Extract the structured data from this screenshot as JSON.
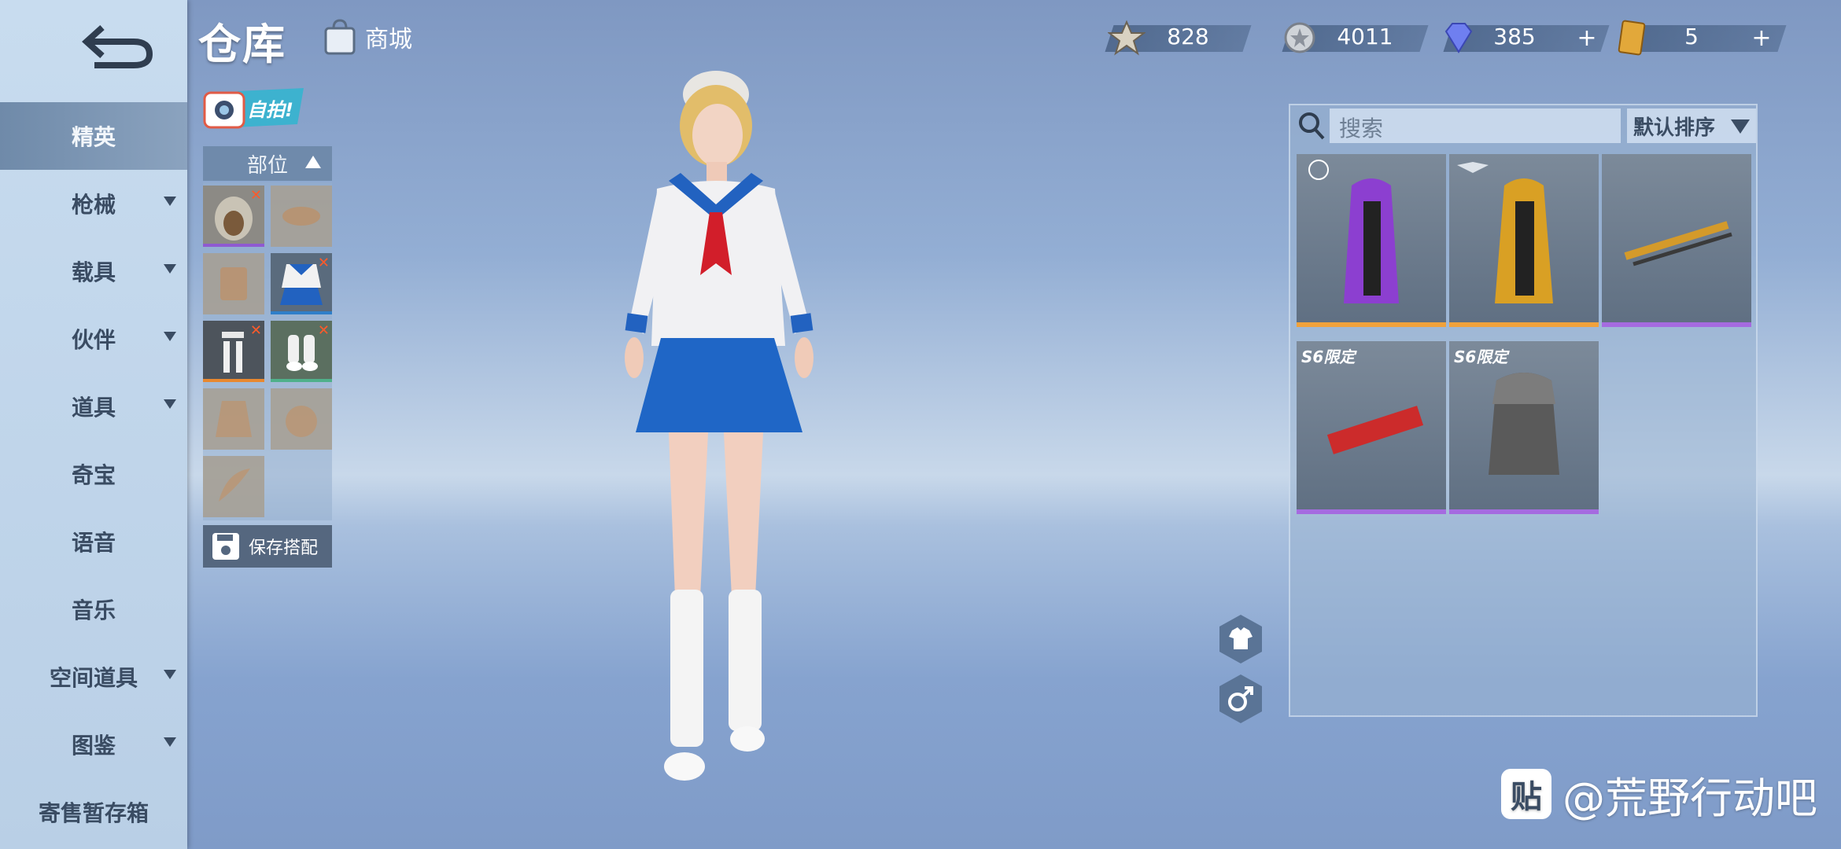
{
  "title": "仓库",
  "shop_label": "商城",
  "selfie_label": "自拍!",
  "sidebar": {
    "items": [
      {
        "label": "精英",
        "active": true,
        "dropdown": false
      },
      {
        "label": "枪械",
        "active": false,
        "dropdown": true
      },
      {
        "label": "载具",
        "active": false,
        "dropdown": true
      },
      {
        "label": "伙伴",
        "active": false,
        "dropdown": true
      },
      {
        "label": "道具",
        "active": false,
        "dropdown": true
      },
      {
        "label": "奇宝",
        "active": false,
        "dropdown": false
      },
      {
        "label": "语音",
        "active": false,
        "dropdown": false
      },
      {
        "label": "音乐",
        "active": false,
        "dropdown": false
      },
      {
        "label": "空间道具",
        "active": false,
        "dropdown": true
      },
      {
        "label": "图鉴",
        "active": false,
        "dropdown": true
      },
      {
        "label": "寄售暂存箱",
        "active": false,
        "dropdown": false
      }
    ]
  },
  "parts": {
    "header": "部位",
    "save_label": "保存搭配"
  },
  "currency": {
    "medals": "828",
    "coins": "4011",
    "diamonds": "385",
    "tickets": "5"
  },
  "inventory": {
    "search_placeholder": "搜索",
    "sort_label": "默认排序",
    "items": [
      {
        "name": "purple-cloak",
        "tag": "",
        "rarity_color": "#f0a23c"
      },
      {
        "name": "gold-cloak",
        "tag": "",
        "rarity_color": "#f0a23c"
      },
      {
        "name": "katana-pair",
        "tag": "",
        "rarity_color": "#a56be0"
      },
      {
        "name": "red-sword-case",
        "tag": "S6限定",
        "rarity_color": "#a56be0"
      },
      {
        "name": "quilted-cape",
        "tag": "S6限定",
        "rarity_color": "#a56be0"
      }
    ]
  },
  "watermark": "@荒野行动吧",
  "watermark_logo": "贴"
}
